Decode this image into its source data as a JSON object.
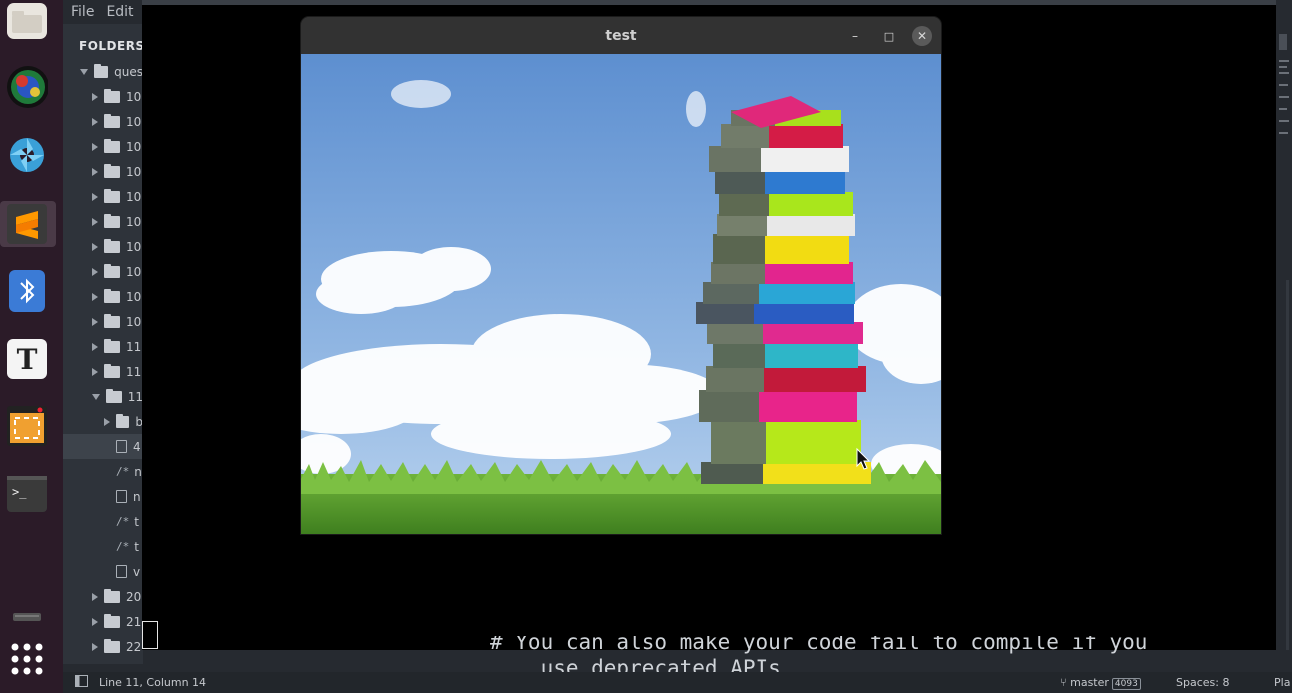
{
  "editor": {
    "menu": [
      "File",
      "Edit"
    ],
    "sidebar_title": "FOLDERS",
    "tree": [
      {
        "label": "ques",
        "type": "folder",
        "expanded": true,
        "indent": 0
      },
      {
        "label": "10",
        "type": "folder",
        "expanded": false,
        "indent": 1
      },
      {
        "label": "10",
        "type": "folder",
        "expanded": false,
        "indent": 1
      },
      {
        "label": "10",
        "type": "folder",
        "expanded": false,
        "indent": 1
      },
      {
        "label": "10",
        "type": "folder",
        "expanded": false,
        "indent": 1
      },
      {
        "label": "10",
        "type": "folder",
        "expanded": false,
        "indent": 1
      },
      {
        "label": "10",
        "type": "folder",
        "expanded": false,
        "indent": 1
      },
      {
        "label": "10",
        "type": "folder",
        "expanded": false,
        "indent": 1
      },
      {
        "label": "10",
        "type": "folder",
        "expanded": false,
        "indent": 1
      },
      {
        "label": "10",
        "type": "folder",
        "expanded": false,
        "indent": 1
      },
      {
        "label": "10",
        "type": "folder",
        "expanded": false,
        "indent": 1
      },
      {
        "label": "11",
        "type": "folder",
        "expanded": false,
        "indent": 1
      },
      {
        "label": "11",
        "type": "folder",
        "expanded": false,
        "indent": 1
      },
      {
        "label": "11",
        "type": "folder",
        "expanded": true,
        "indent": 1
      },
      {
        "label": "b",
        "type": "folder",
        "expanded": false,
        "indent": 2
      },
      {
        "label": "4",
        "type": "file",
        "indent": 2,
        "selected": true
      },
      {
        "label": "n",
        "type": "code",
        "indent": 2
      },
      {
        "label": "n",
        "type": "file",
        "indent": 2
      },
      {
        "label": "t",
        "type": "code",
        "indent": 2
      },
      {
        "label": "t",
        "type": "code",
        "indent": 2
      },
      {
        "label": "v",
        "type": "image",
        "indent": 2
      },
      {
        "label": "20",
        "type": "folder",
        "expanded": false,
        "indent": 1
      },
      {
        "label": "21",
        "type": "folder",
        "expanded": false,
        "indent": 1
      },
      {
        "label": "22",
        "type": "folder",
        "expanded": false,
        "indent": 1
      }
    ],
    "code_lines": [
      "# You can also make your code fail to compile if you",
      "    use deprecated APIs"
    ]
  },
  "window": {
    "title": "test",
    "minimize_glyph": "–",
    "maximize_glyph": "□",
    "close_glyph": "✕"
  },
  "statusbar": {
    "position": "Line 11, Column 14",
    "branch": "master",
    "branch_count": "4093",
    "spaces": "Spaces: 8",
    "syntax": "Pla"
  },
  "dock": {
    "icons": [
      "files-icon",
      "globe-app-icon",
      "shutter-app-icon",
      "sublime-text-icon",
      "bluetooth-icon",
      "typora-icon",
      "screenshot-app-icon",
      "terminal-icon",
      "drive-icon",
      "app-grid-icon"
    ],
    "typora_letter": "T",
    "terminal_prompt": ">_"
  }
}
